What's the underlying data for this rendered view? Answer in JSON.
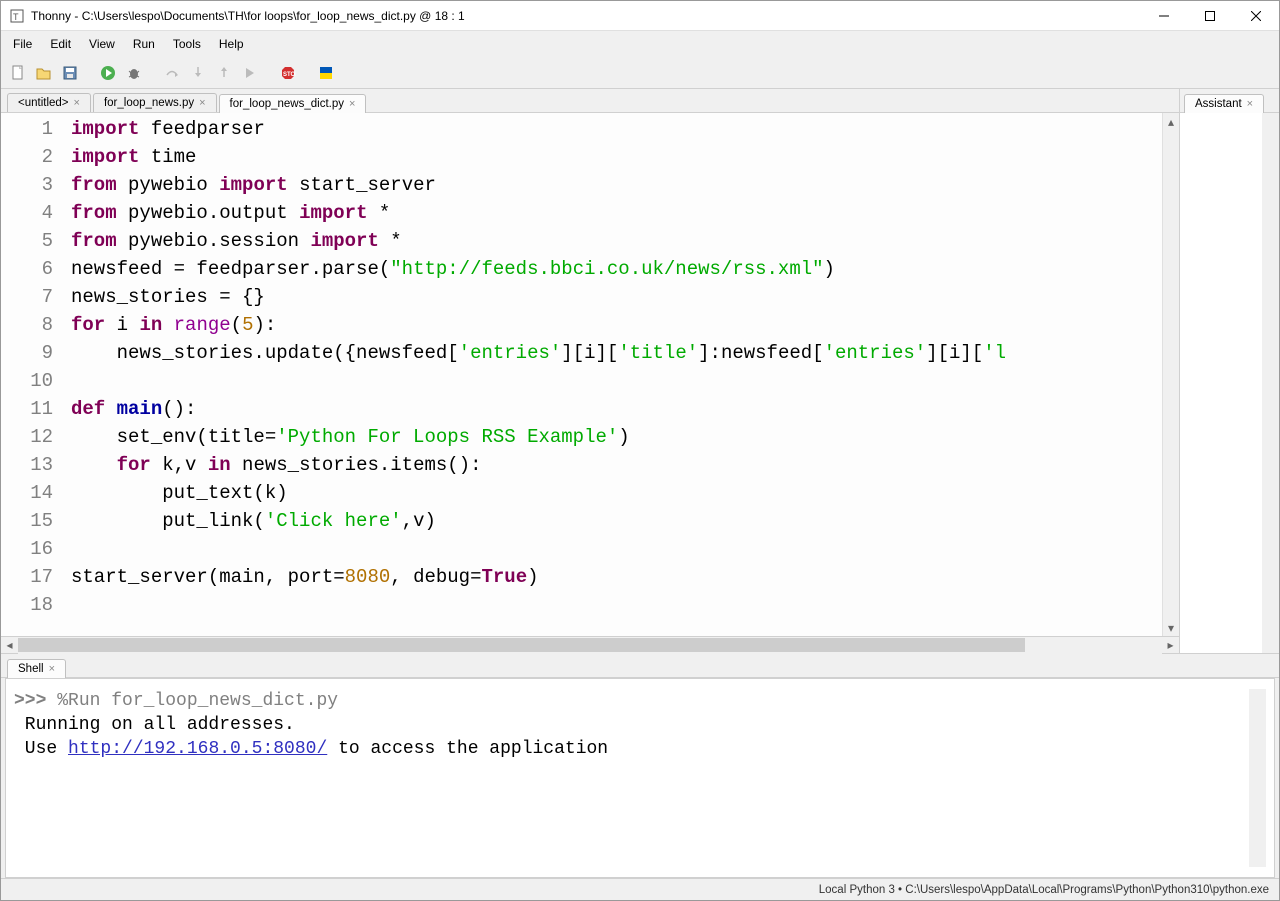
{
  "titlebar": {
    "text": "Thonny  -  C:\\Users\\lespo\\Documents\\TH\\for loops\\for_loop_news_dict.py  @  18 : 1"
  },
  "menu": [
    "File",
    "Edit",
    "View",
    "Run",
    "Tools",
    "Help"
  ],
  "tabs": [
    {
      "label": "<untitled>",
      "active": false
    },
    {
      "label": "for_loop_news.py",
      "active": false
    },
    {
      "label": "for_loop_news_dict.py",
      "active": true
    }
  ],
  "gutter": [
    "1",
    "2",
    "3",
    "4",
    "5",
    "6",
    "7",
    "8",
    "9",
    "10",
    "11",
    "12",
    "13",
    "14",
    "15",
    "16",
    "17",
    "18"
  ],
  "code": {
    "l1": {
      "kw1": "import",
      "id": "feedparser"
    },
    "l2": {
      "kw1": "import",
      "id": "time"
    },
    "l3": {
      "kw1": "from",
      "mod": "pywebio",
      "kw2": "import",
      "id": "start_server"
    },
    "l4": {
      "kw1": "from",
      "mod": "pywebio.output",
      "kw2": "import",
      "star": "*"
    },
    "l5": {
      "kw1": "from",
      "mod": "pywebio.session",
      "kw2": "import",
      "star": "*"
    },
    "l6": {
      "pre": "newsfeed = feedparser.parse(",
      "str": "\"http://feeds.bbci.co.uk/news/rss.xml\"",
      "post": ")"
    },
    "l7": {
      "txt": "news_stories = {}"
    },
    "l8": {
      "kw1": "for",
      "var": " i ",
      "kw2": "in",
      "fn": " range",
      "open": "(",
      "num": "5",
      "close": "):"
    },
    "l9": {
      "pre": "    news_stories.update({newsfeed[",
      "s1": "'entries'",
      "m1": "][i][",
      "s2": "'title'",
      "m2": "]:newsfeed[",
      "s3": "'entries'",
      "m3": "][i][",
      "s4": "'l"
    },
    "l11": {
      "kw1": "def",
      "fn": " main",
      "rest": "():"
    },
    "l12": {
      "pre": "    set_env(title=",
      "str": "'Python For Loops RSS Example'",
      "post": ")"
    },
    "l13": {
      "kw1": "for",
      "mid": " k,v ",
      "kw2": "in",
      "rest": " news_stories.items():"
    },
    "l14": {
      "txt": "        put_text(k)"
    },
    "l15": {
      "pre": "        put_link(",
      "str": "'Click here'",
      "post": ",v)"
    },
    "l17": {
      "pre": "start_server(main, port=",
      "num": "8080",
      "mid": ", debug=",
      "bool": "True",
      "post": ")"
    }
  },
  "assistant": {
    "tab": "Assistant"
  },
  "shell": {
    "tab": "Shell",
    "prompt": ">>> ",
    "cmd": "%Run for_loop_news_dict.py",
    "out1": " Running on all addresses.",
    "out2a": " Use ",
    "link": "http://192.168.0.5:8080/",
    "out2b": " to access the application"
  },
  "status": "Local Python 3  •  C:\\Users\\lespo\\AppData\\Local\\Programs\\Python\\Python310\\python.exe"
}
